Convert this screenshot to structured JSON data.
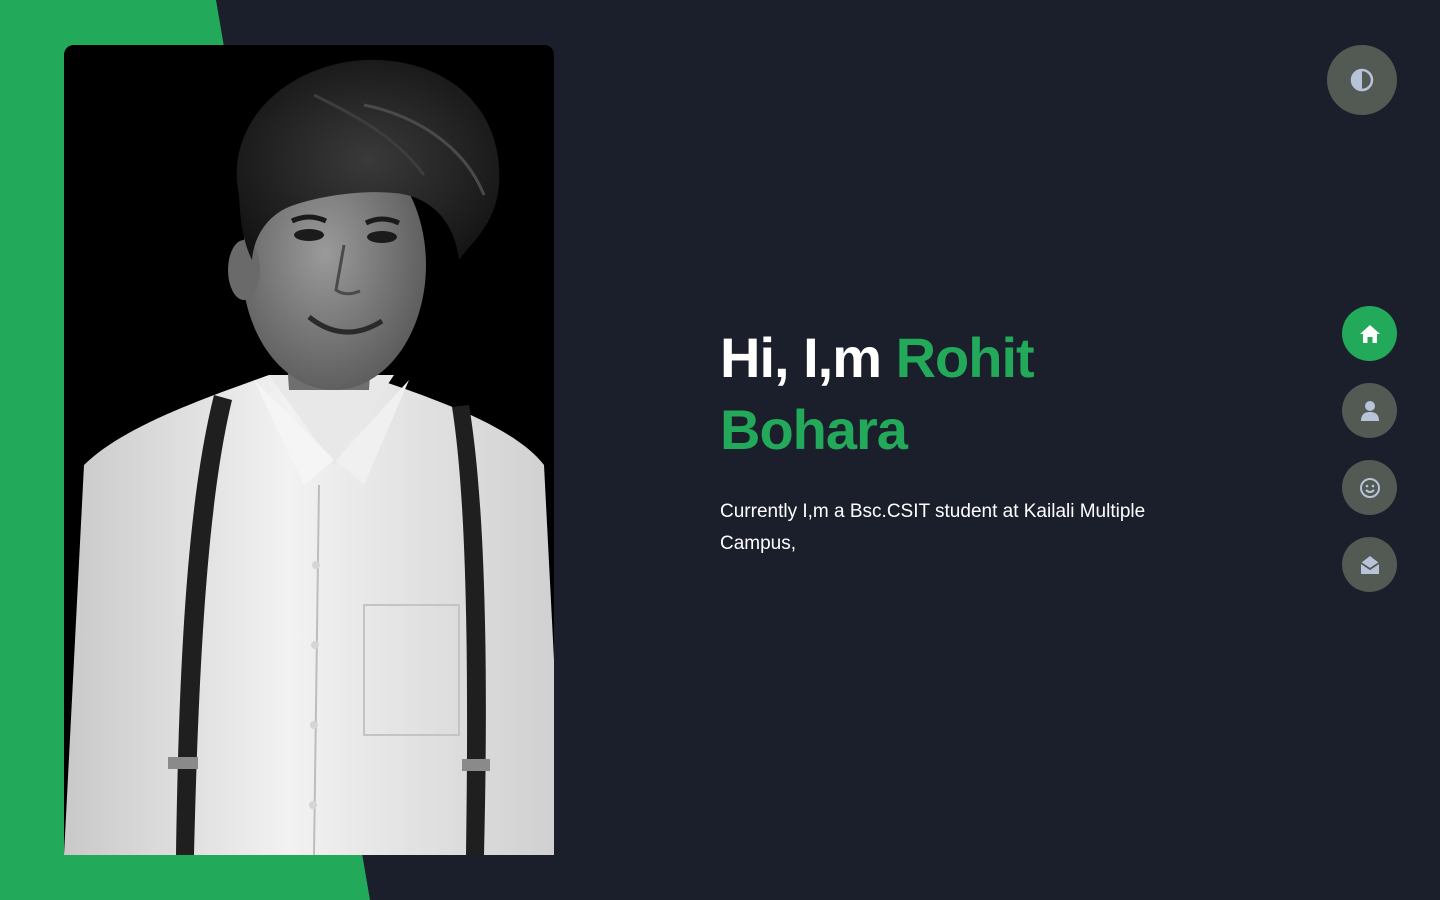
{
  "hero": {
    "greeting": "Hi, I,m",
    "first_name": "Rohit",
    "last_name": "Bohara",
    "description": "Currently I,m a Bsc.CSIT student at Kailali Multiple Campus,"
  },
  "nav": {
    "items": [
      {
        "icon": "home-icon",
        "active": true
      },
      {
        "icon": "user-icon",
        "active": false
      },
      {
        "icon": "smile-icon",
        "active": false
      },
      {
        "icon": "envelope-open-icon",
        "active": false
      }
    ]
  },
  "theme_toggle": {
    "icon": "contrast-icon"
  },
  "colors": {
    "background": "#1b1e2b",
    "accent": "#23a95a",
    "button_gray": "#535a54",
    "icon_light": "#b7c3d9"
  }
}
